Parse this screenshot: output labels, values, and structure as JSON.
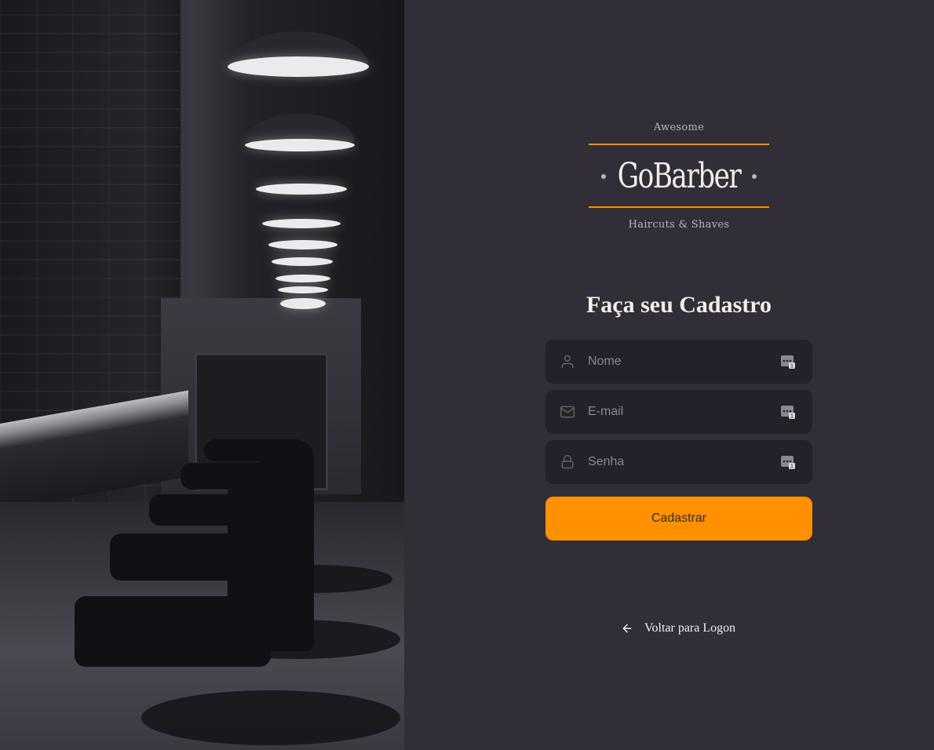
{
  "logo": {
    "top_text": "Awesome",
    "name": "GoBarber",
    "bottom_text": "Haircuts & Shaves"
  },
  "form": {
    "title": "Faça seu Cadastro",
    "fields": [
      {
        "icon": "user-icon",
        "placeholder": "Nome",
        "value": ""
      },
      {
        "icon": "mail-icon",
        "placeholder": "E-mail",
        "value": ""
      },
      {
        "icon": "lock-icon",
        "placeholder": "Senha",
        "value": ""
      }
    ],
    "submit_label": "Cadastrar"
  },
  "back_link": {
    "icon": "arrow-left-icon",
    "label": "Voltar para Logon"
  },
  "colors": {
    "background": "#312e38",
    "input_background": "#232129",
    "accent": "#ff9000",
    "text": "#f4ede8",
    "placeholder": "#8a8790"
  }
}
